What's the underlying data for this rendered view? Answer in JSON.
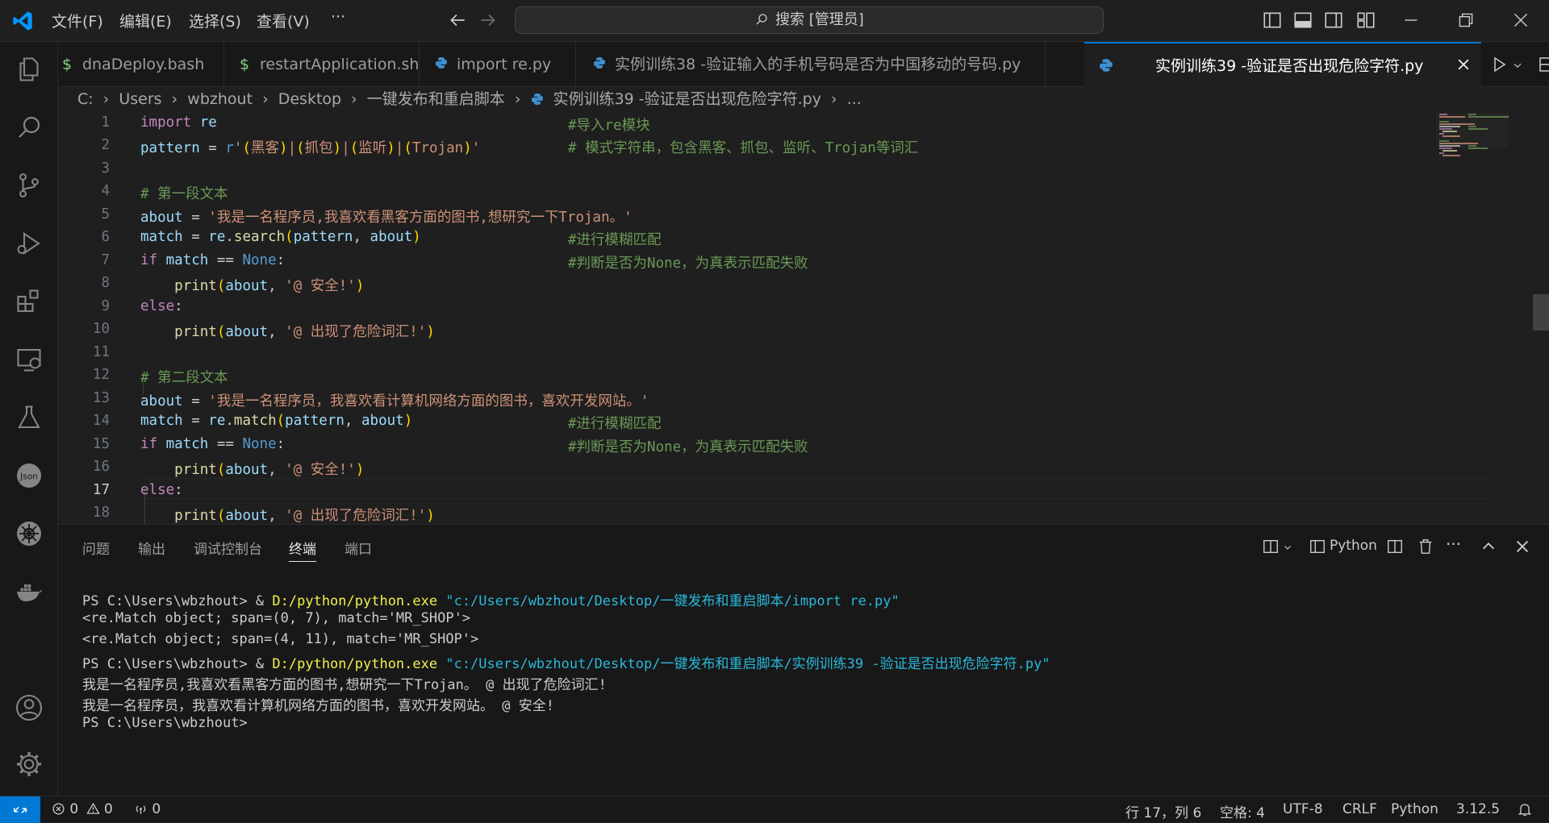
{
  "menu": [
    "文件(F)",
    "编辑(E)",
    "选择(S)",
    "查看(V)",
    "···"
  ],
  "search": {
    "label": "搜索 [管理员]"
  },
  "tabs": [
    {
      "icon": "$",
      "label": "dnaDeploy.bash",
      "active": false
    },
    {
      "icon": "$",
      "label": "restartApplication.sh",
      "active": false
    },
    {
      "icon": "py",
      "label": "import re.py",
      "active": false
    },
    {
      "icon": "py",
      "label": "实例训练38 -验证输入的手机号码是否为中国移动的号码.py",
      "active": false
    },
    {
      "icon": "py",
      "label": "实例训练39 -验证是否出现危险字符.py",
      "active": true
    }
  ],
  "breadcrumb": {
    "parts": [
      "C:",
      "Users",
      "wbzhout",
      "Desktop",
      "一键发布和重启脚本",
      "实例训练39 -验证是否出现危险字符.py",
      "..."
    ]
  },
  "editor": {
    "current_line": 17,
    "lines": [
      {
        "n": "1",
        "code": "import re",
        "comment": "#导入re模块"
      },
      {
        "n": "2",
        "code": "pattern = r'(黑客)|(抓包)|(监听)|(Trojan)'",
        "comment": "# 模式字符串，包含黑客、抓包、监听、Trojan等词汇"
      },
      {
        "n": "3",
        "code": "",
        "comment": ""
      },
      {
        "n": "4",
        "code": "# 第一段文本",
        "comment": ""
      },
      {
        "n": "5",
        "code": "about = '我是一名程序员,我喜欢看黑客方面的图书,想研究一下Trojan。'",
        "comment": ""
      },
      {
        "n": "6",
        "code": "match = re.search(pattern, about)",
        "comment": "#进行模糊匹配"
      },
      {
        "n": "7",
        "code": "if match == None:",
        "comment": "#判断是否为None，为真表示匹配失败"
      },
      {
        "n": "8",
        "code": "    print(about, '@ 安全!')",
        "comment": ""
      },
      {
        "n": "9",
        "code": "else:",
        "comment": ""
      },
      {
        "n": "10",
        "code": "    print(about, '@ 出现了危险词汇!')",
        "comment": ""
      },
      {
        "n": "11",
        "code": "",
        "comment": ""
      },
      {
        "n": "12",
        "code": "# 第二段文本",
        "comment": ""
      },
      {
        "n": "13",
        "code": "about = '我是一名程序员，我喜欢看计算机网络方面的图书，喜欢开发网站。'",
        "comment": ""
      },
      {
        "n": "14",
        "code": "match = re.match(pattern, about)",
        "comment": "#进行模糊匹配"
      },
      {
        "n": "15",
        "code": "if match == None:",
        "comment": "#判断是否为None，为真表示匹配失败"
      },
      {
        "n": "16",
        "code": "    print(about, '@ 安全!')",
        "comment": ""
      },
      {
        "n": "17",
        "code": "else:",
        "comment": ""
      },
      {
        "n": "18",
        "code": "    print(about, '@ 出现了危险词汇!')",
        "comment": ""
      }
    ]
  },
  "panel": {
    "tabs": [
      "问题",
      "输出",
      "调试控制台",
      "终端",
      "端口"
    ],
    "active_tab": "终端",
    "shell": "Python",
    "terminal": [
      {
        "prompt": "PS C:\\Users\\wbzhout> & ",
        "exe": "D:/python/python.exe",
        "arg": " \"c:/Users/wbzhout/Desktop/一键发布和重启脚本/import re.py\"",
        "text": ""
      },
      {
        "prompt": "",
        "exe": "",
        "arg": "",
        "text": "<re.Match object; span=(0, 7), match='MR_SHOP'>"
      },
      {
        "prompt": "",
        "exe": "",
        "arg": "",
        "text": "<re.Match object; span=(4, 11), match='MR_SHOP'>"
      },
      {
        "prompt": "PS C:\\Users\\wbzhout> & ",
        "exe": "D:/python/python.exe",
        "arg": " \"c:/Users/wbzhout/Desktop/一键发布和重启脚本/实例训练39 -验证是否出现危险字符.py\"",
        "text": ""
      },
      {
        "prompt": "",
        "exe": "",
        "arg": "",
        "text": "我是一名程序员,我喜欢看黑客方面的图书,想研究一下Trojan。 @ 出现了危险词汇!"
      },
      {
        "prompt": "",
        "exe": "",
        "arg": "",
        "text": "我是一名程序员，我喜欢看计算机网络方面的图书，喜欢开发网站。 @ 安全!"
      },
      {
        "prompt": "",
        "exe": "",
        "arg": "",
        "text": "PS C:\\Users\\wbzhout>"
      }
    ]
  },
  "statusbar": {
    "errors": "0",
    "warnings": "0",
    "ports": "0",
    "position": "行 17，列 6",
    "spaces": "空格: 4",
    "encoding": "UTF-8",
    "eol": "CRLF",
    "language": "Python",
    "version": "3.12.5"
  },
  "colors": {
    "accent": "#0078d4",
    "keyword": "#c586c0",
    "string": "#ce9178",
    "comment": "#6a9955",
    "function": "#dcdcaa",
    "constant": "#569cd6"
  }
}
